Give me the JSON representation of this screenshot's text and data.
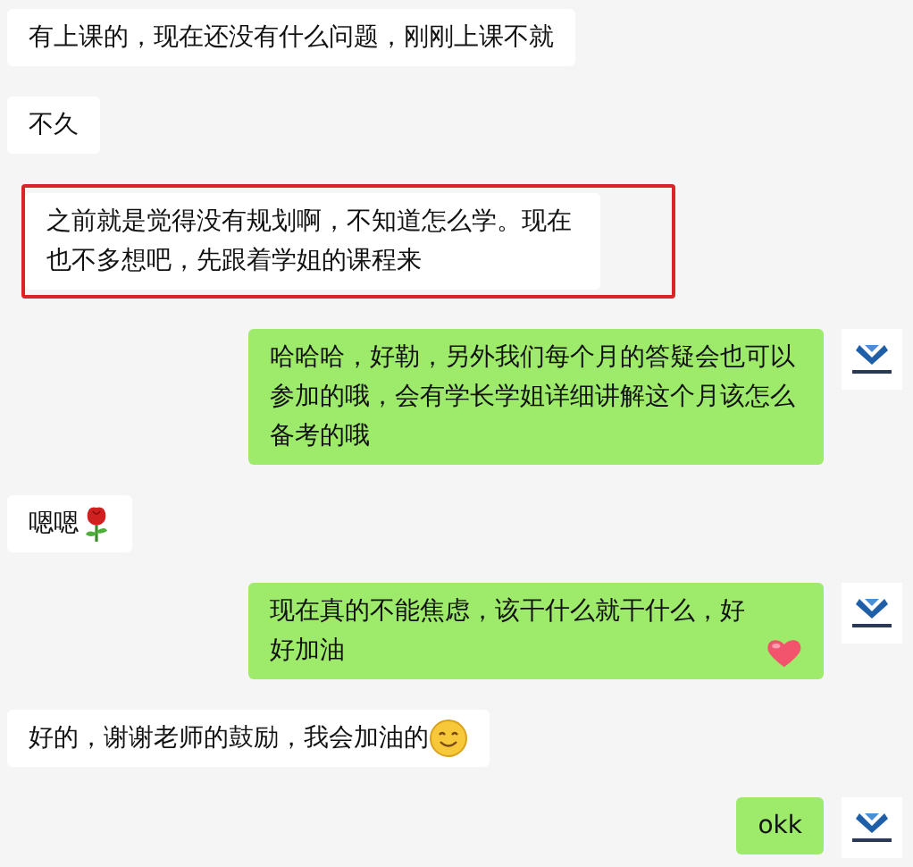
{
  "messages": [
    {
      "kind": "incoming",
      "text": "有上课的，现在还没有什么问题，刚刚上课不就"
    },
    {
      "kind": "incoming",
      "text": "不久"
    },
    {
      "kind": "incoming",
      "text": "之前就是觉得没有规划啊，不知道怎么学。现在也不多想吧，先跟着学姐的课程来",
      "highlighted": true
    },
    {
      "kind": "outgoing",
      "text": "哈哈哈，好勒，另外我们每个月的答疑会也可以参加的哦，会有学长学姐详细讲解这个月该怎么备考的哦"
    },
    {
      "kind": "incoming",
      "text": "嗯嗯",
      "emoji": {
        "kind": "rose"
      }
    },
    {
      "kind": "outgoing",
      "text": "现在真的不能焦虑，该干什么就干什么，好好加油",
      "emoji": {
        "kind": "heart"
      }
    },
    {
      "kind": "incoming",
      "text": "好的，谢谢老师的鼓励，我会加油的",
      "emoji": {
        "kind": "smile"
      }
    },
    {
      "kind": "outgoing",
      "text": "okk"
    }
  ]
}
